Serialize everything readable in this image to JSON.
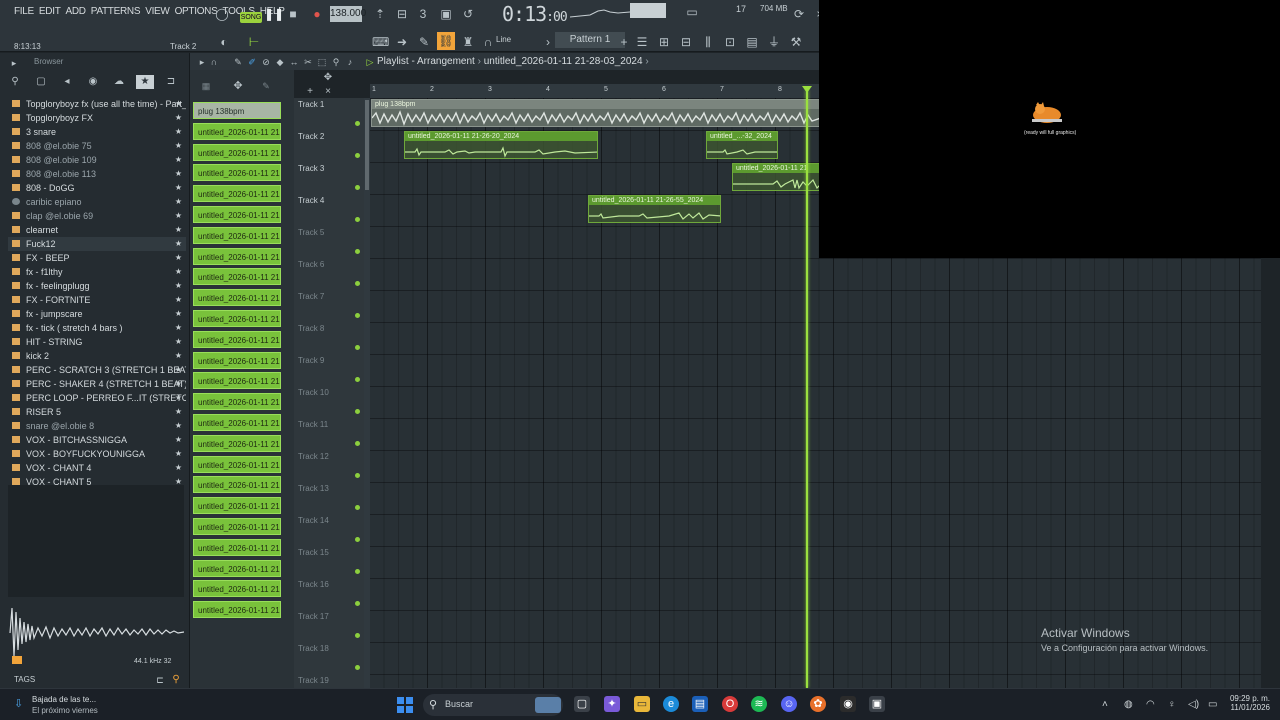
{
  "menu": [
    "FILE",
    "EDIT",
    "ADD",
    "PATTERNS",
    "VIEW",
    "OPTIONS",
    "TOOLS",
    "HELP"
  ],
  "transport": {
    "song_mode": "SONG",
    "tempo": "138.000",
    "time": "0:13",
    "time_small": ":00",
    "cpu": "17",
    "memory": "704 MB",
    "hint_time": "8:13:13",
    "hint_track": "Track 2",
    "snap": "Line",
    "pattern": "Pattern 1"
  },
  "browser": {
    "title": "Browser",
    "items": [
      {
        "label": "Topgloryboyz fx (use all the time) - Part_1",
        "kind": "folder"
      },
      {
        "label": "Topgloryboyz FX",
        "kind": "folder"
      },
      {
        "label": "3 snare",
        "kind": "folder"
      },
      {
        "label": "808 @el.obie 75",
        "kind": "folder",
        "dim": true
      },
      {
        "label": "808 @el.obie 109",
        "kind": "folder",
        "dim": true
      },
      {
        "label": "808 @el.obie 113",
        "kind": "folder",
        "dim": true
      },
      {
        "label": "808 - DoGG",
        "kind": "folder"
      },
      {
        "label": "caribic epiano",
        "kind": "file",
        "dim": true
      },
      {
        "label": "clap @el.obie 69",
        "kind": "folder",
        "dim": true
      },
      {
        "label": "clearnet",
        "kind": "folder"
      },
      {
        "label": "Fuck12",
        "kind": "folder",
        "selected": true
      },
      {
        "label": "FX - BEEP",
        "kind": "folder"
      },
      {
        "label": "fx - f1lthy",
        "kind": "folder"
      },
      {
        "label": "fx - feelingplugg",
        "kind": "folder"
      },
      {
        "label": "FX - FORTNITE",
        "kind": "folder"
      },
      {
        "label": "fx - jumpscare",
        "kind": "folder"
      },
      {
        "label": "fx - tick ( stretch 4 bars )",
        "kind": "folder"
      },
      {
        "label": "HIT - STRING",
        "kind": "folder"
      },
      {
        "label": "kick 2",
        "kind": "folder"
      },
      {
        "label": "PERC - SCRATCH 3 (STRETCH 1 BEAT)",
        "kind": "folder"
      },
      {
        "label": "PERC - SHAKER 4 (STRETCH 1 BEAT)",
        "kind": "folder"
      },
      {
        "label": "PERC LOOP - PERREO F...IT (STRETCH 4 BARS)",
        "kind": "folder"
      },
      {
        "label": "RISER 5",
        "kind": "folder"
      },
      {
        "label": "snare @el.obie 8",
        "kind": "folder",
        "dim": true
      },
      {
        "label": "VOX - BITCHASSNIGGA",
        "kind": "folder"
      },
      {
        "label": "VOX - BOYFUCKYOUNIGGA",
        "kind": "folder"
      },
      {
        "label": "VOX - CHANT 4",
        "kind": "folder"
      },
      {
        "label": "VOX - CHANT 5",
        "kind": "folder"
      }
    ],
    "sample_info": "44.1 kHz 32",
    "tags_label": "TAGS"
  },
  "picker": {
    "items": [
      "plug 138bpm",
      "untitled_2026-01-11 21-...",
      "untitled_2026-01-11 21-...",
      "untitled_2026-01-11 21-...",
      "untitled_2026-01-11 21-...",
      "untitled_2026-01-11 21-...",
      "untitled_2026-01-11 21-...",
      "untitled_2026-01-11 21-...",
      "untitled_2026-01-11 21-...",
      "untitled_2026-01-11 21-...",
      "untitled_2026-01-11 21-...",
      "untitled_2026-01-11 21-...",
      "untitled_2026-01-11 21-...",
      "untitled_2026-01-11 21-...",
      "untitled_2026-01-11 21-...",
      "untitled_2026-01-11 21-...",
      "untitled_2026-01-11 21-...",
      "untitled_2026-01-11 21-...",
      "untitled_2026-01-11 21-...",
      "untitled_2026-01-11 21-...",
      "untitled_2026-01-11 21-...",
      "untitled_2026-01-11 21-...",
      "untitled_2026-01-11 21-...",
      "untitled_2026-01-11 21-...",
      "untitled_2026-01-11 21-..."
    ],
    "highlighted_index": 14
  },
  "playlist": {
    "title": "Playlist - Arrangement",
    "breadcrumb": "untitled_2026-01-11 21-28-03_2024",
    "ruler": [
      "1",
      "2",
      "3",
      "4",
      "5",
      "6",
      "7",
      "8"
    ],
    "tracks": [
      "Track 1",
      "Track 2",
      "Track 3",
      "Track 4",
      "Track 5",
      "Track 6",
      "Track 7",
      "Track 8",
      "Track 9",
      "Track 10",
      "Track 11",
      "Track 12",
      "Track 13",
      "Track 14",
      "Track 15",
      "Track 16",
      "Track 17",
      "Track 18",
      "Track 19"
    ],
    "clips": [
      {
        "label": "plug 138bpm",
        "track": 1,
        "kind": "plug"
      },
      {
        "label": "untitled_2026-01-11 21-26-20_2024",
        "track": 2,
        "kind": "audio"
      },
      {
        "label": "untitled_...-32_2024",
        "track": 2,
        "kind": "audio"
      },
      {
        "label": "untitled_2026-01-11 21",
        "track": 3,
        "kind": "audio"
      },
      {
        "label": "untitled_2026-01-11 21-26-55_2024",
        "track": 4,
        "kind": "audio"
      }
    ]
  },
  "overlay": {
    "caption": "(ready will full graphics)"
  },
  "watermark": {
    "line1": "Activar Windows",
    "line2": "Ve a Configuración para activar Windows."
  },
  "taskbar": {
    "weather_line1": "Bajada de las te...",
    "weather_line2": "El próximo viernes",
    "search_placeholder": "Buscar",
    "time": "09:29 p. m.",
    "date": "11/01/2026"
  },
  "colors": {
    "accent": "#79c23b",
    "playhead": "#9be03f",
    "folder": "#e0a85b"
  }
}
